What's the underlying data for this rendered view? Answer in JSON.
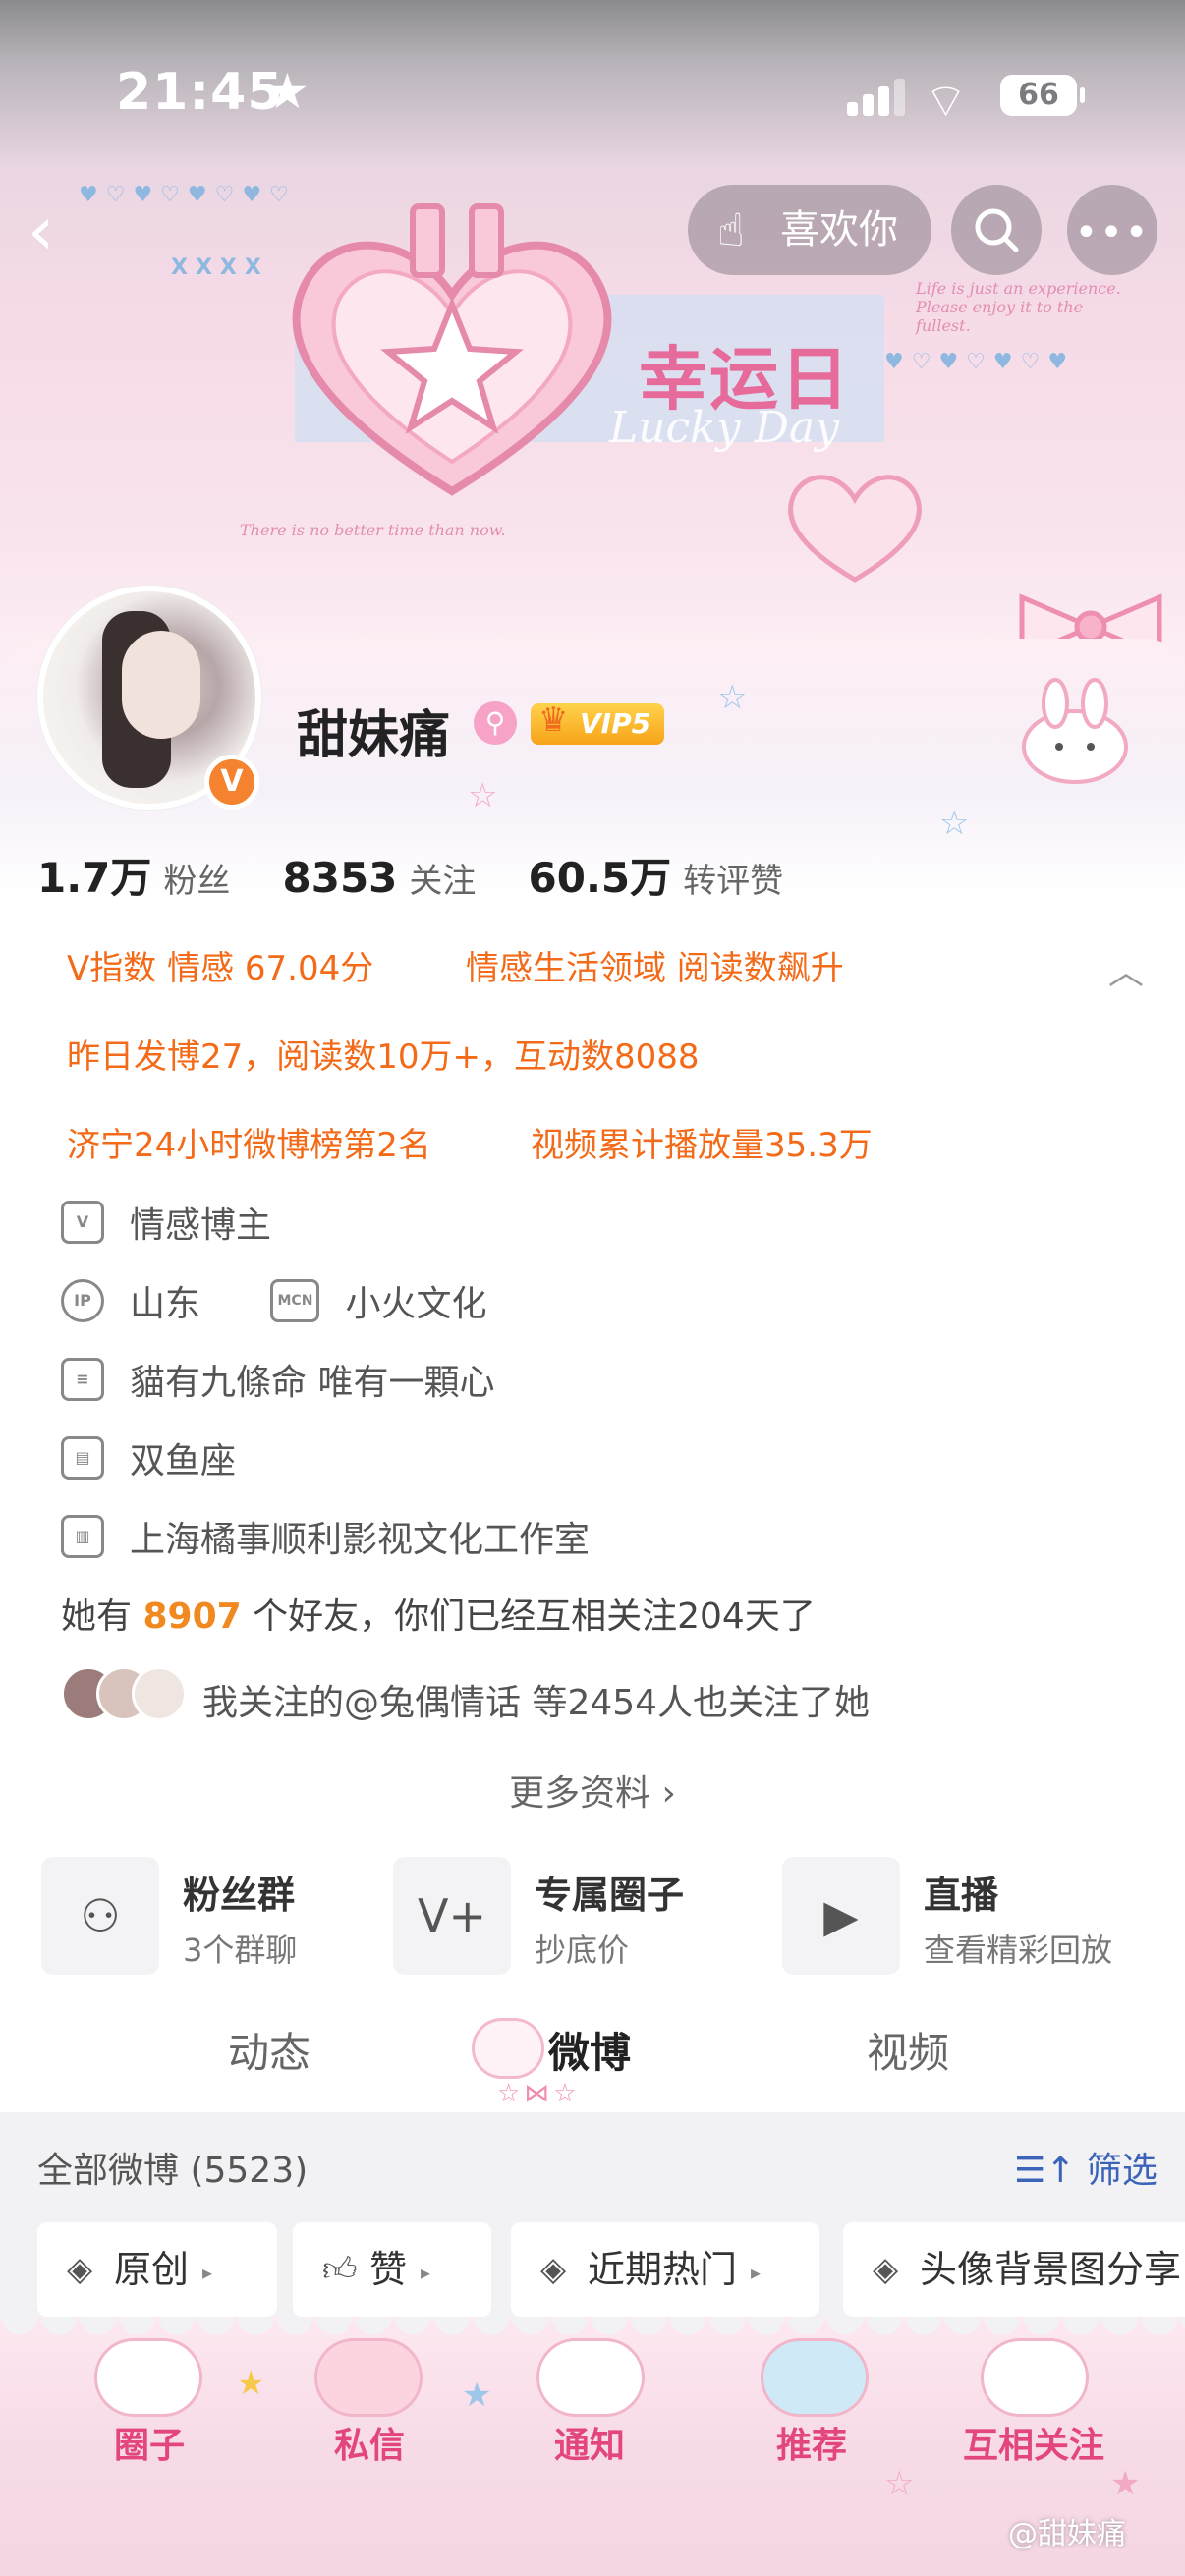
{
  "status_bar": {
    "time": "21:45",
    "battery": "66"
  },
  "header": {
    "like_label": "喜欢你"
  },
  "banner": {
    "title": "幸运日",
    "subtitle": "Lucky Day",
    "quote_bottom": "There is no better time than now.",
    "quote_right": "Life is just an experience. Please enjoy it to the fullest.",
    "mark_left": "XXXX"
  },
  "profile": {
    "name": "甜妹痛",
    "vip_label": "VIP5",
    "verified_badge": "V",
    "stats": [
      {
        "value": "1.7万",
        "label": "粉丝"
      },
      {
        "value": "8353",
        "label": "关注"
      },
      {
        "value": "60.5万",
        "label": "转评赞"
      }
    ],
    "highlights": {
      "v_index": "V指数 情感 67.04分",
      "domain": "情感生活领域 阅读数飙升",
      "yesterday": "昨日发博27，阅读数10万+，互动数8088",
      "rank": "济宁24小时微博榜第2名",
      "video": "视频累计播放量35.3万"
    },
    "info": {
      "category": "情感博主",
      "ip_label": "IP",
      "ip": "山东",
      "mcn_label": "MCN",
      "mcn": "小火文化",
      "bio": "貓有九條命 唯有一顆心",
      "zodiac": "双鱼座",
      "company": "上海橘事顺利影视文化工作室"
    },
    "friends": {
      "prefix": "她有",
      "count": "8907",
      "suffix": "个好友，你们已经互相关注204天了"
    },
    "mutual": "我关注的@兔偶情话 等2454人也关注了她",
    "more": "更多资料 ›"
  },
  "features": [
    {
      "title": "粉丝群",
      "sub": "3个群聊"
    },
    {
      "title": "专属圈子",
      "sub": "抄底价"
    },
    {
      "title": "直播",
      "sub": "查看精彩回放"
    }
  ],
  "tabs": [
    "动态",
    "微博",
    "视频"
  ],
  "feed": {
    "title": "全部微博 (5523)",
    "filter": "筛选",
    "chips": [
      "原创",
      "赞",
      "近期热门",
      "头像背景图分享"
    ]
  },
  "bottom_nav": [
    "圈子",
    "私信",
    "通知",
    "推荐",
    "互相关注"
  ],
  "watermark": "@甜妹痛",
  "colors": {
    "accent_orange": "#f36a18",
    "nav_pink": "#e2467c",
    "filter_blue": "#3b64b8"
  }
}
